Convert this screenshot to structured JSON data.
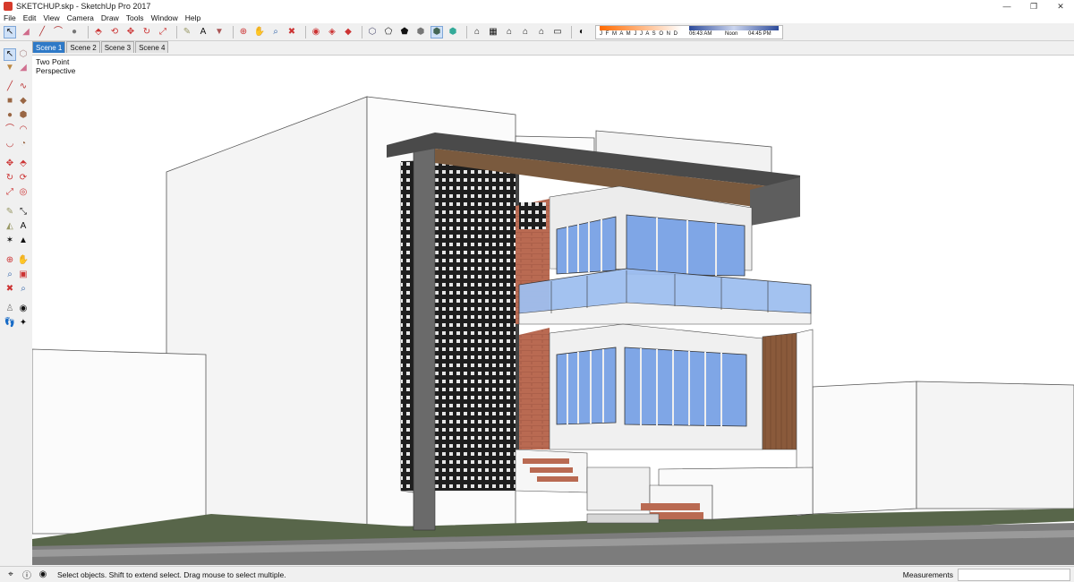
{
  "window": {
    "title": "SKETCHUP.skp - SketchUp Pro 2017",
    "minimize": "—",
    "restore": "❐",
    "close": "✕"
  },
  "menu": [
    "File",
    "Edit",
    "View",
    "Camera",
    "Draw",
    "Tools",
    "Window",
    "Help"
  ],
  "shadow_settings": {
    "months": "J F M A M J J A S O N D",
    "time_start": "06:43 AM",
    "time_noon": "Noon",
    "time_end": "04:45 PM"
  },
  "scenes": {
    "tabs": [
      "Scene 1",
      "Scene 2",
      "Scene 3",
      "Scene 4"
    ],
    "active": "Scene 1"
  },
  "viewport": {
    "camera_label_line1": "Two Point",
    "camera_label_line2": "Perspective"
  },
  "status": {
    "message": "Select objects. Shift to extend select. Drag mouse to select multiple.",
    "measurements_label": "Measurements",
    "measurements_value": ""
  },
  "colors": {
    "scene_tab_active": "#2e79c7",
    "glass": "#7fa6e6",
    "brick": "#b96a52",
    "wood": "#8a5a3b",
    "ground": "#5a6a4a"
  }
}
